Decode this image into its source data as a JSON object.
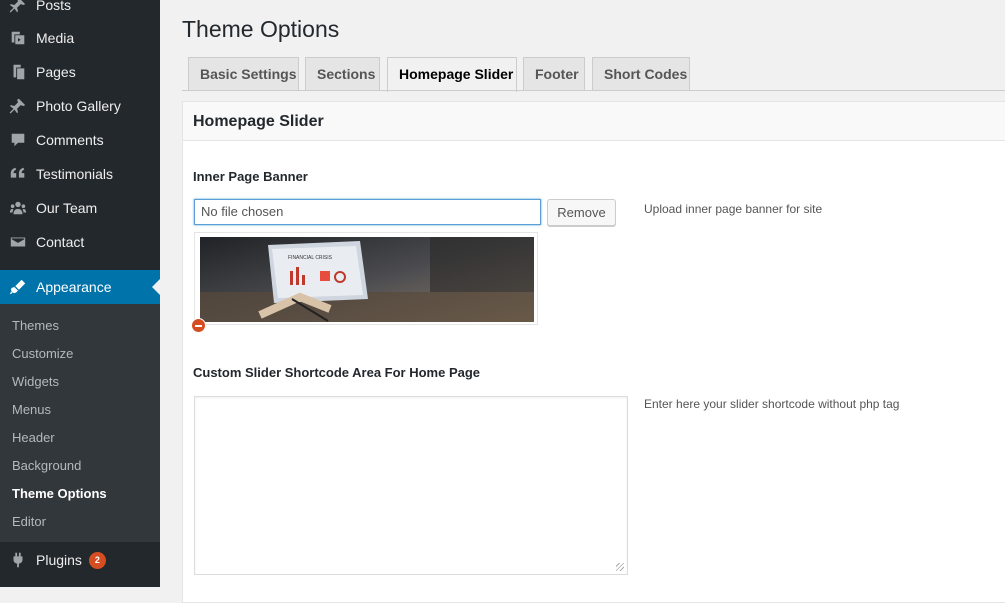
{
  "sidebar": {
    "items": [
      {
        "label": "Posts",
        "icon": "pin-icon"
      },
      {
        "label": "Media",
        "icon": "media-icon"
      },
      {
        "label": "Pages",
        "icon": "pages-icon"
      },
      {
        "label": "Photo Gallery",
        "icon": "pin-icon"
      },
      {
        "label": "Comments",
        "icon": "comment-icon"
      },
      {
        "label": "Testimonials",
        "icon": "quote-icon"
      },
      {
        "label": "Our Team",
        "icon": "team-icon"
      },
      {
        "label": "Contact",
        "icon": "mail-icon"
      },
      {
        "label": "Appearance",
        "icon": "brush-icon"
      },
      {
        "label": "Plugins",
        "icon": "plugin-icon",
        "badge": "2"
      }
    ],
    "submenu": [
      "Themes",
      "Customize",
      "Widgets",
      "Menus",
      "Header",
      "Background",
      "Theme Options",
      "Editor"
    ],
    "accent_color": "#0073aa",
    "badge_color": "#d54e21"
  },
  "main": {
    "title": "Theme Options",
    "tabs": [
      "Basic Settings",
      "Sections",
      "Homepage Slider",
      "Footer",
      "Short Codes"
    ],
    "active_tab": "Homepage Slider",
    "panel": {
      "title": "Homepage Slider",
      "banner": {
        "label": "Inner Page Banner",
        "file_value": "No file chosen",
        "remove_label": "Remove",
        "description": "Upload inner page banner for site",
        "image_text": "FINANCIAL CRISIS"
      },
      "shortcode": {
        "label": "Custom Slider Shortcode Area For Home Page",
        "description": "Enter here your slider shortcode without php tag",
        "value": ""
      }
    }
  }
}
